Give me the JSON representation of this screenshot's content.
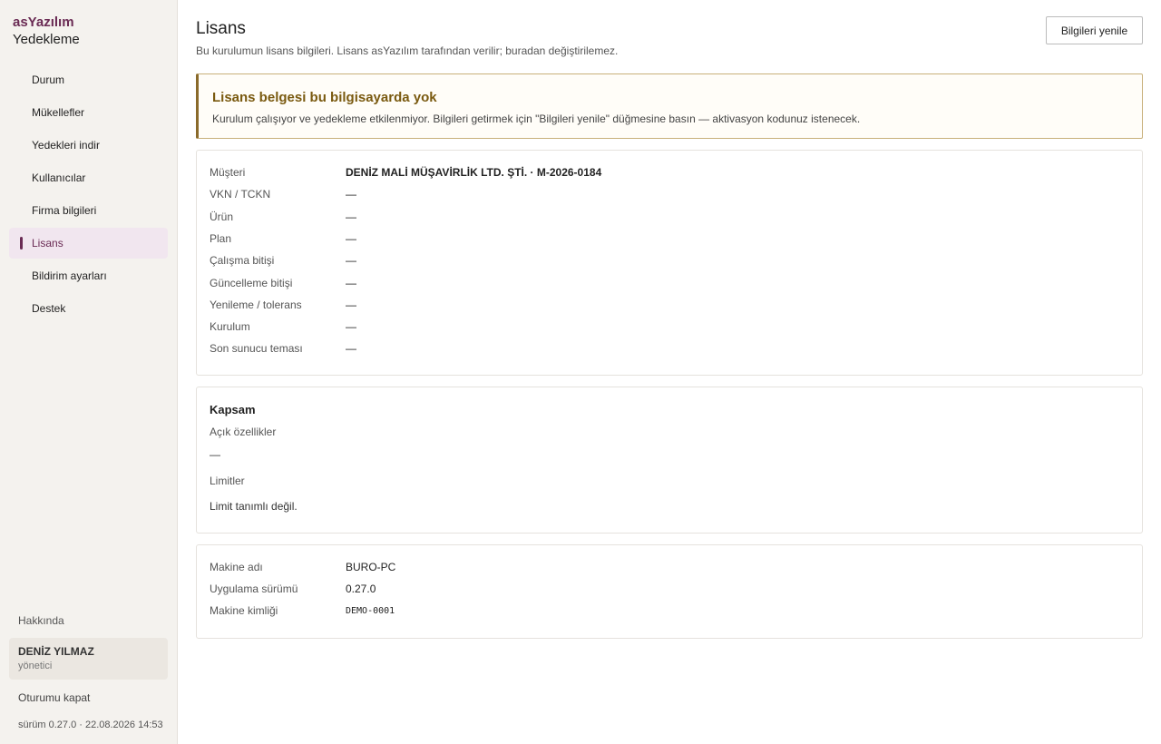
{
  "brand": {
    "top": "asYazılım",
    "bottom": "Yedekleme"
  },
  "nav": [
    {
      "label": "Durum"
    },
    {
      "label": "Mükellefler"
    },
    {
      "label": "Yedekleri indir"
    },
    {
      "label": "Kullanıcılar"
    },
    {
      "label": "Firma bilgileri"
    },
    {
      "label": "Lisans",
      "active": true
    },
    {
      "label": "Bildirim ayarları"
    },
    {
      "label": "Destek"
    }
  ],
  "sidebar_footer": {
    "about": "Hakkında",
    "user_name": "DENİZ YILMAZ",
    "user_role": "yönetici",
    "logout": "Oturumu kapat",
    "version": "sürüm 0.27.0 · 22.08.2026 14:53"
  },
  "header": {
    "title": "Lisans",
    "subtitle": "Bu kurulumun lisans bilgileri. Lisans asYazılım tarafından verilir; buradan değiştirilemez.",
    "refresh_label": "Bilgileri yenile"
  },
  "warning": {
    "title": "Lisans belgesi bu bilgisayarda yok",
    "text": "Kurulum çalışıyor ve yedekleme etkilenmiyor. Bilgileri getirmek için \"Bilgileri yenile\" düğmesine basın — aktivasyon kodunuz istenecek."
  },
  "license": [
    {
      "key": "Müşteri",
      "value": "DENİZ MALİ MÜŞAVİRLİK LTD. ŞTİ. · M-2026-0184"
    },
    {
      "key": "VKN / TCKN",
      "value": "—"
    },
    {
      "key": "Ürün",
      "value": "—"
    },
    {
      "key": "Plan",
      "value": "—"
    },
    {
      "key": "Çalışma bitişi",
      "value": "—"
    },
    {
      "key": "Güncelleme bitişi",
      "value": "—"
    },
    {
      "key": "Yenileme / tolerans",
      "value": "—"
    },
    {
      "key": "Kurulum",
      "value": "—"
    },
    {
      "key": "Son sunucu teması",
      "value": "—"
    }
  ],
  "scope": {
    "title": "Kapsam",
    "features_label": "Açık özellikler",
    "features_value": "—",
    "limits_label": "Limitler",
    "limits_value": "Limit tanımlı değil."
  },
  "machine": [
    {
      "key": "Makine adı",
      "value": "BURO-PC"
    },
    {
      "key": "Uygulama sürümü",
      "value": "0.27.0"
    },
    {
      "key": "Makine kimliği",
      "value": "DEMO-0001"
    }
  ],
  "colors": {
    "accent": "#6a2b54",
    "warning": "#7a5a10",
    "sidebar_bg": "#f4f2ee"
  }
}
